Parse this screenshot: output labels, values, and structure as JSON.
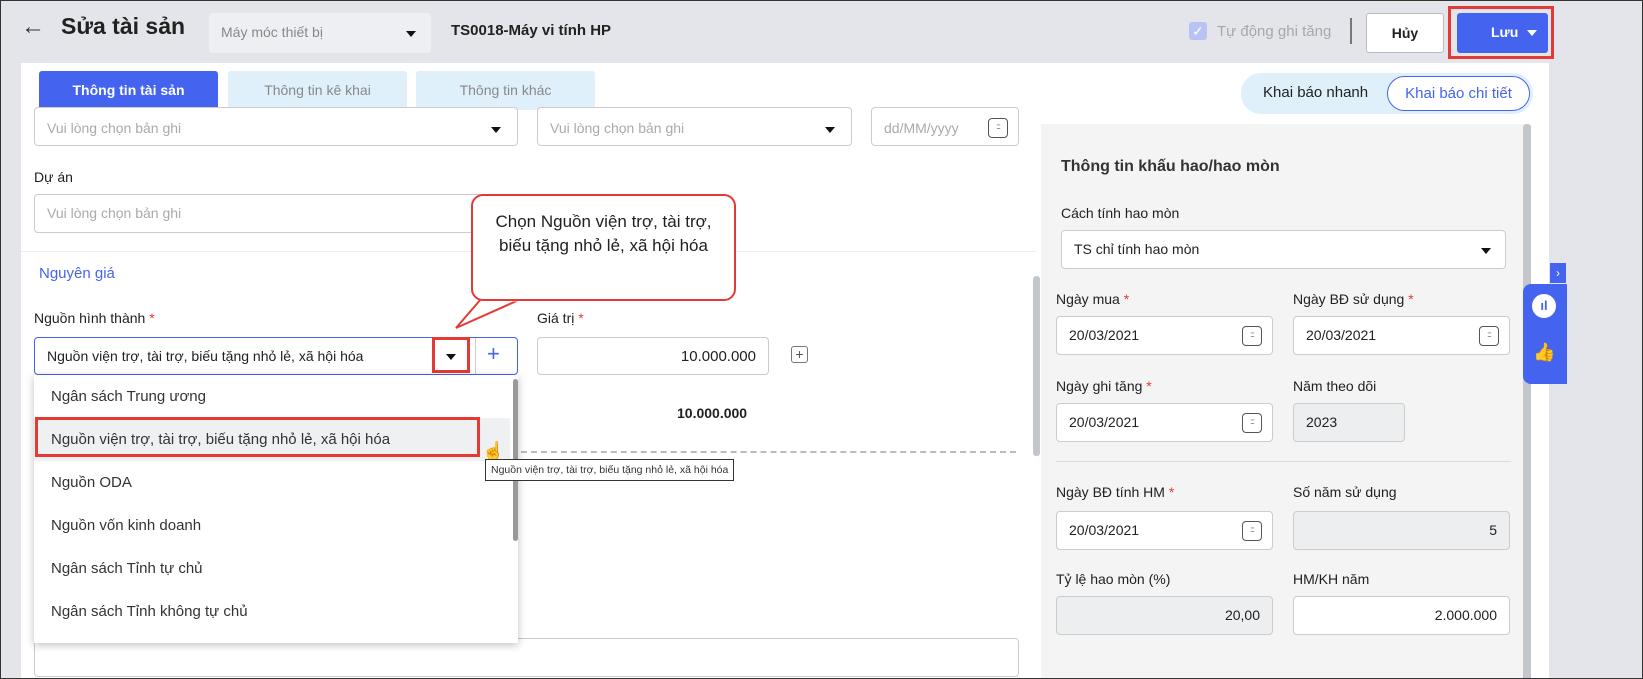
{
  "header": {
    "title": "Sửa tài sản",
    "category": "Máy móc thiết bị",
    "asset_code": "TS0018-Máy vi tính HP",
    "auto_increase_label": "Tự động ghi tăng",
    "auto_increase_checked": true,
    "cancel_label": "Hủy",
    "save_label": "Lưu"
  },
  "tabs": [
    {
      "label": "Thông tin tài sản"
    },
    {
      "label": "Thông tin kê khai"
    },
    {
      "label": "Thông tin khác"
    }
  ],
  "mode_toggle": {
    "quick": "Khai báo nhanh",
    "detail": "Khai báo chi tiết"
  },
  "form": {
    "placeholder": "Vui lòng chọn bản ghi",
    "date_placeholder": "dd/MM/yyyy",
    "project_label": "Dự án",
    "section_label": "Nguyên giá",
    "source_label": "Nguồn hình thành",
    "source_value": "Nguồn viện trợ, tài trợ, biếu tặng nhỏ lẻ, xã hội hóa",
    "value_label": "Giá trị",
    "value": "10.000.000",
    "total": "10.000.000",
    "required_mark": "*"
  },
  "dropdown": {
    "items": [
      "Ngân sách Trung ương",
      "Nguồn viện trợ, tài trợ, biếu tặng nhỏ lẻ, xã hội hóa",
      "Nguồn ODA",
      "Nguồn vốn kinh doanh",
      "Ngân sách Tỉnh tự chủ",
      "Ngân sách Tỉnh không tự chủ"
    ],
    "tooltip": "Nguồn viện trợ, tài trợ, biếu tặng nhỏ lẻ, xã hội hóa"
  },
  "callout": "Chọn Nguồn viện trợ, tài trợ, biếu tặng nhỏ lẻ, xã hội hóa",
  "depreciation": {
    "title": "Thông tin khấu hao/hao mòn",
    "method_label": "Cách tính hao mòn",
    "method_value": "TS chỉ tính hao mòn",
    "purchase_date_label": "Ngày mua",
    "purchase_date": "20/03/2021",
    "use_start_label": "Ngày BĐ sử dụng",
    "use_start": "20/03/2021",
    "increase_date_label": "Ngày ghi tăng",
    "increase_date": "20/03/2021",
    "track_year_label": "Năm theo dõi",
    "track_year": "2023",
    "dep_start_label": "Ngày BĐ tính HM",
    "dep_start": "20/03/2021",
    "years_label": "Số năm sử dụng",
    "years": "5",
    "rate_label": "Tỷ lệ hao mòn (%)",
    "rate": "20,00",
    "annual_label": "HM/KH năm",
    "annual": "2.000.000"
  },
  "colors": {
    "primary": "#4464ef",
    "highlight": "#e53935",
    "tab_inactive": "#dff0fb"
  }
}
